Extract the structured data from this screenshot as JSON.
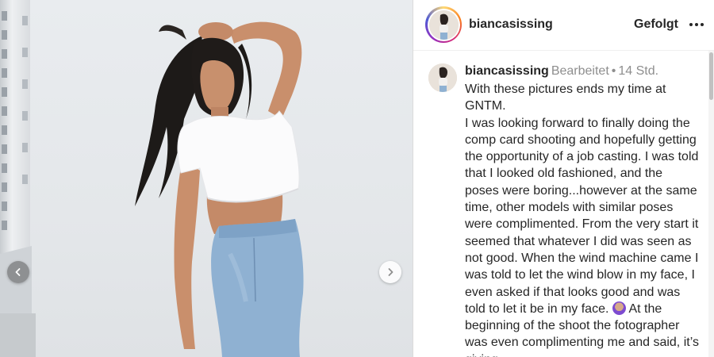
{
  "post": {
    "username": "biancasissing",
    "follow_label": "Gefolgt",
    "more_label": "More options"
  },
  "comment": {
    "username": "biancasissing",
    "edited": "Bearbeitet",
    "separator": "•",
    "time": "14 Std.",
    "caption_lines": [
      "With these pictures ends my time at GNTM.",
      "I was looking forward to finally doing the comp card shooting and hopefully getting the opportunity of a job casting. I was told that I looked old fashioned, and the poses were boring...however at the same time, other models with similar poses were complimented. From the very start it seemed that whatever I did was seen as not good. When the wind machine came I was told to let the wind blow in my face, I even asked if that looks good and was told to let it be in my face.",
      "At the beginning of the shoot the fotographer was even complimenting me and said, it’s giving"
    ],
    "emoji_name": "person-shrugging-emoji"
  },
  "carousel": {
    "prev_icon": "chevron-left-icon",
    "next_icon": "chevron-right-icon"
  },
  "colors": {
    "text": "#262626",
    "muted": "#8e8e8e",
    "border": "#dbdbdb"
  }
}
